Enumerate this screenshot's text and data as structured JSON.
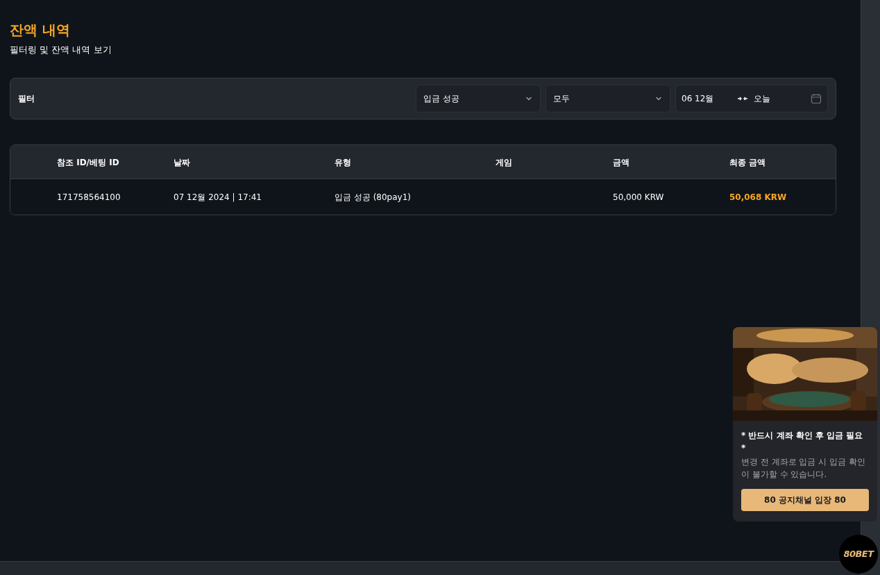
{
  "page": {
    "title": "잔액 내역",
    "subtitle": "필터링 및 잔액 내역 보기"
  },
  "filter": {
    "label": "필터",
    "type_select": "입금 성공",
    "game_select": "모두",
    "date_from": "06 12월",
    "date_to": "오늘"
  },
  "table": {
    "columns": [
      "참조 ID/베팅 ID",
      "날짜",
      "유형",
      "게임",
      "금액",
      "최종 금액"
    ],
    "rows": [
      {
        "cells": [
          "171758564100",
          "07 12월 2024 | 17:41",
          "입금 성공 (80pay1)",
          "",
          "50,000 KRW",
          "50,068 KRW"
        ]
      }
    ]
  },
  "popup": {
    "title": "* 반드시 계좌 확인 후 입금 필요 *",
    "text": "변경 전 계좌로 입금 시 입금 확인이 불가할 수 있습니다.",
    "button": "80 공지채널 입장 80"
  },
  "logo_badge": {
    "text": "80BET"
  }
}
